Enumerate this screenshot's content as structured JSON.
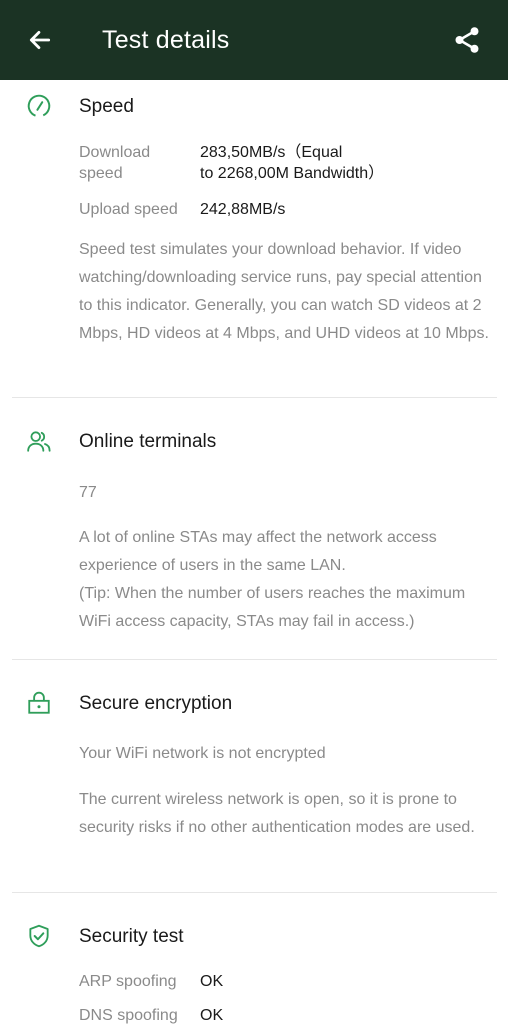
{
  "header": {
    "title": "Test details",
    "back_icon": "arrow-left-icon",
    "share_icon": "share-icon",
    "background": "#1b3324"
  },
  "accent_color": "#2f9e5a",
  "speed": {
    "title": "Speed",
    "download_label": "Download speed",
    "download_label_line1": "Download",
    "download_label_line2": "speed",
    "download_value_line1": "283,50MB/s（Equal",
    "download_value_line2": "to 2268,00M Bandwidth）",
    "upload_label": "Upload speed",
    "upload_value": "242,88MB/s",
    "description": "Speed test simulates your download behavior. If video watching/downloading service runs, pay special attention to this indicator. Generally, you can watch SD videos at 2 Mbps, HD videos at 4 Mbps, and UHD videos at 10 Mbps."
  },
  "online_terminals": {
    "title": "Online terminals",
    "count": "77",
    "description_line1": "A lot of online STAs may affect the network access experience of users in the same LAN.",
    "description_line2": "(Tip: When the number of users reaches the maximum WiFi access capacity, STAs may fail in access.)"
  },
  "secure_encryption": {
    "title": "Secure encryption",
    "status": "Your WiFi network is not encrypted",
    "description": "The current wireless network is open, so it is prone to security risks if no other authentication modes are used."
  },
  "security_test": {
    "title": "Security test",
    "rows": [
      {
        "label": "ARP spoofing",
        "value": "OK"
      },
      {
        "label": "DNS spoofing",
        "value": "OK"
      }
    ]
  }
}
